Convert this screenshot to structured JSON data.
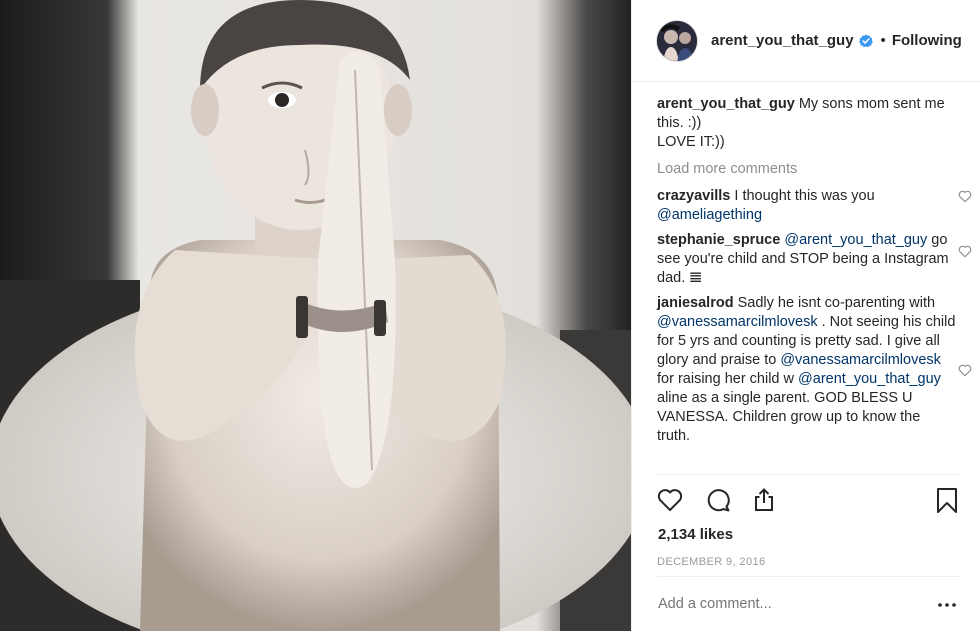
{
  "post": {
    "username": "arent_you_that_guy",
    "follow_status": "Following",
    "separator": "•",
    "caption": {
      "username": "arent_you_that_guy",
      "text_line1": " My sons mom sent me this. :))",
      "text_line2": "LOVE IT:))"
    },
    "load_more": "Load more comments",
    "comments": [
      {
        "username": "crazyavills",
        "parts": [
          " I thought this was you ",
          "@ameliagething"
        ]
      },
      {
        "username": "stephanie_spruce",
        "parts": [
          " ",
          "@arent_you_that_guy",
          " go see you're child and STOP being a Instagram dad. 𝌆"
        ]
      },
      {
        "username": "janiesalrod",
        "parts": [
          " Sadly he isnt co-parenting with ",
          "@vanessamarcilmlovesk",
          " . Not seeing his child for 5 yrs and counting is pretty sad. I give all glory and praise to ",
          "@vanessamarcilmlovesk",
          " for raising her child w ",
          "@arent_you_that_guy",
          " aline as a single parent. GOD BLESS U VANESSA. Children grow up to know the truth."
        ]
      }
    ],
    "likes": "2,134 likes",
    "date": "DECEMBER 9, 2016",
    "add_comment_placeholder": "Add a comment...",
    "more_label": "•••"
  },
  "colors": {
    "text": "#262626",
    "muted": "#8e8e8e",
    "mention": "#003569",
    "verified": "#3897f0",
    "divider": "#efefef"
  },
  "icons": [
    "heart-icon",
    "comment-icon",
    "share-icon",
    "bookmark-icon",
    "verified-badge-icon",
    "more-options-icon"
  ]
}
